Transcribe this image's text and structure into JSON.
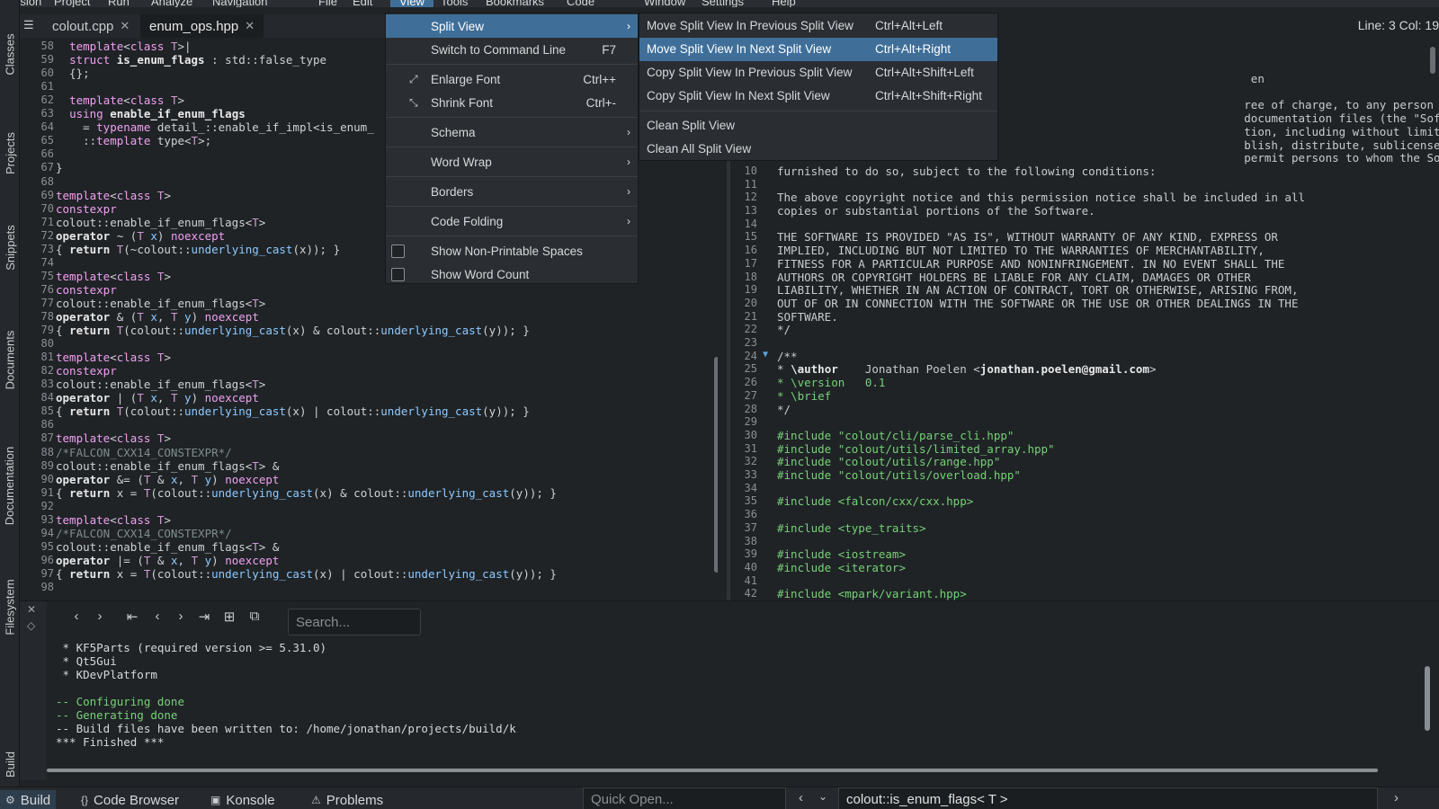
{
  "menubar": {
    "items": [
      "Session",
      "Project",
      "Run",
      "Analyze",
      "Navigation",
      "File",
      "Edit",
      "View",
      "Tools",
      "Bookmarks",
      "Code",
      "Window",
      "Settings",
      "Help"
    ],
    "active": "View"
  },
  "tabs": [
    {
      "label": "colout.cpp"
    },
    {
      "label": "enum_ops.hpp"
    }
  ],
  "tab_close_glyph": "✕",
  "status": {
    "line_col": "Line: 3 Col: 19"
  },
  "left_dock": [
    "Classes",
    "Projects",
    "Snippets",
    "Documents",
    "Documentation",
    "Filesystem",
    "Build"
  ],
  "editor1": {
    "lines": [
      {
        "n": "58",
        "html": "  <span class=\"kw\">template</span>&lt;<span class=\"kw\">class</span> <span class=\"tp\">T</span>&gt;|"
      },
      {
        "n": "59",
        "html": "  <span class=\"kw\">struct</span> <span class=\"bold\">is_enum_flags</span> : std::false_type"
      },
      {
        "n": "60",
        "html": "  {};"
      },
      {
        "n": "61",
        "html": ""
      },
      {
        "n": "62",
        "html": "  <span class=\"kw\">template</span>&lt;<span class=\"kw\">class</span> <span class=\"tp\">T</span>&gt;"
      },
      {
        "n": "63",
        "html": "  <span class=\"kw\">using</span> <span class=\"bold\">enable_if_enum_flags</span>"
      },
      {
        "n": "64",
        "html": "    = <span class=\"kw\">typename</span> detail_::enable_if_impl&lt;is_enum_"
      },
      {
        "n": "65",
        "html": "    ::<span class=\"kw\">template</span> type&lt;<span class=\"tp\">T</span>&gt;;"
      },
      {
        "n": "66",
        "html": ""
      },
      {
        "n": "67",
        "html": "}"
      },
      {
        "n": "68",
        "html": ""
      },
      {
        "n": "69",
        "html": "<span class=\"kw\">template</span>&lt;<span class=\"kw\">class</span> <span class=\"tp\">T</span>&gt;"
      },
      {
        "n": "70",
        "html": "<span class=\"kw\">constexpr</span>"
      },
      {
        "n": "71",
        "html": "colout::enable_if_enum_flags&lt;<span class=\"tp\">T</span>&gt;"
      },
      {
        "n": "72",
        "html": "<span class=\"bold\">operator</span> ~ (<span class=\"tp\">T</span> <span class=\"fn\">x</span>) <span class=\"kw\">noexcept</span>"
      },
      {
        "n": "73",
        "html": "{ <span class=\"bold\">return</span> <span class=\"tp\">T</span>(~colout::<span class=\"fn\">underlying_cast</span>(x)); }"
      },
      {
        "n": "74",
        "html": ""
      },
      {
        "n": "75",
        "html": "<span class=\"kw\">template</span>&lt;<span class=\"kw\">class</span> <span class=\"tp\">T</span>&gt;"
      },
      {
        "n": "76",
        "html": "<span class=\"kw\">constexpr</span>"
      },
      {
        "n": "77",
        "html": "colout::enable_if_enum_flags&lt;<span class=\"tp\">T</span>&gt;"
      },
      {
        "n": "78",
        "html": "<span class=\"bold\">operator</span> &amp; (<span class=\"tp\">T</span> <span class=\"fn\">x</span>, <span class=\"tp\">T</span> <span class=\"fn\">y</span>) <span class=\"kw\">noexcept</span>"
      },
      {
        "n": "79",
        "html": "{ <span class=\"bold\">return</span> <span class=\"tp\">T</span>(colout::<span class=\"fn\">underlying_cast</span>(x) &amp; colout::<span class=\"fn\">underlying_cast</span>(y)); }"
      },
      {
        "n": "80",
        "html": ""
      },
      {
        "n": "81",
        "html": "<span class=\"kw\">template</span>&lt;<span class=\"kw\">class</span> <span class=\"tp\">T</span>&gt;"
      },
      {
        "n": "82",
        "html": "<span class=\"kw\">constexpr</span>"
      },
      {
        "n": "83",
        "html": "colout::enable_if_enum_flags&lt;<span class=\"tp\">T</span>&gt;"
      },
      {
        "n": "84",
        "html": "<span class=\"bold\">operator</span> | (<span class=\"tp\">T</span> <span class=\"fn\">x</span>, <span class=\"tp\">T</span> <span class=\"fn\">y</span>) <span class=\"kw\">noexcept</span>"
      },
      {
        "n": "85",
        "html": "{ <span class=\"bold\">return</span> <span class=\"tp\">T</span>(colout::<span class=\"fn\">underlying_cast</span>(x) | colout::<span class=\"fn\">underlying_cast</span>(y)); }"
      },
      {
        "n": "86",
        "html": ""
      },
      {
        "n": "87",
        "html": "<span class=\"kw\">template</span>&lt;<span class=\"kw\">class</span> <span class=\"tp\">T</span>&gt;"
      },
      {
        "n": "88",
        "html": "<span class=\"cm\">/*FALCON_CXX14_CONSTEXPR*/</span>"
      },
      {
        "n": "89",
        "html": "colout::enable_if_enum_flags&lt;<span class=\"tp\">T</span>&gt; &amp;"
      },
      {
        "n": "90",
        "html": "<span class=\"bold\">operator</span> &amp;= (<span class=\"tp\">T</span> &amp; <span class=\"fn\">x</span>, <span class=\"tp\">T</span> <span class=\"fn\">y</span>) <span class=\"kw\">noexcept</span>"
      },
      {
        "n": "91",
        "html": "{ <span class=\"bold\">return</span> x = <span class=\"tp\">T</span>(colout::<span class=\"fn\">underlying_cast</span>(x) &amp; colout::<span class=\"fn\">underlying_cast</span>(y)); }"
      },
      {
        "n": "92",
        "html": ""
      },
      {
        "n": "93",
        "html": "<span class=\"kw\">template</span>&lt;<span class=\"kw\">class</span> <span class=\"tp\">T</span>&gt;"
      },
      {
        "n": "94",
        "html": "<span class=\"cm\">/*FALCON_CXX14_CONSTEXPR*/</span>"
      },
      {
        "n": "95",
        "html": "colout::enable_if_enum_flags&lt;<span class=\"tp\">T</span>&gt; &amp;"
      },
      {
        "n": "96",
        "html": "<span class=\"bold\">operator</span> |= (<span class=\"tp\">T</span> &amp; <span class=\"fn\">x</span>, <span class=\"tp\">T</span> <span class=\"fn\">y</span>) <span class=\"kw\">noexcept</span>"
      },
      {
        "n": "97",
        "html": "{ <span class=\"bold\">return</span> x = <span class=\"tp\">T</span>(colout::<span class=\"fn\">underlying_cast</span>(x) | colout::<span class=\"fn\">underlying_cast</span>(y)); }"
      },
      {
        "n": "98",
        "html": ""
      }
    ]
  },
  "editor2": {
    "lines": [
      {
        "n": "",
        "html": "                                                                      en"
      },
      {
        "n": "",
        "html": ""
      },
      {
        "n": "",
        "html": "                                                                     ree of charge, to any person obtaining a copy"
      },
      {
        "n": "",
        "html": "                                                                     documentation files (the \"Software\"), to deal"
      },
      {
        "n": "",
        "html": "                                                                     tion, including without limitation the rights"
      },
      {
        "n": "",
        "html": "                                                                     blish, distribute, sublicense, and/or sell"
      },
      {
        "n": "",
        "html": "                                                                     permit persons to whom the Software is"
      },
      {
        "n": "10",
        "html": "furnished to do so, subject to the following conditions:"
      },
      {
        "n": "11",
        "html": ""
      },
      {
        "n": "12",
        "html": "The above copyright notice and this permission notice shall be included in all"
      },
      {
        "n": "13",
        "html": "copies or substantial portions of the Software."
      },
      {
        "n": "14",
        "html": ""
      },
      {
        "n": "15",
        "html": "THE SOFTWARE IS PROVIDED \"AS IS\", WITHOUT WARRANTY OF ANY KIND, EXPRESS OR"
      },
      {
        "n": "16",
        "html": "IMPLIED, INCLUDING BUT NOT LIMITED TO THE WARRANTIES OF MERCHANTABILITY,"
      },
      {
        "n": "17",
        "html": "FITNESS FOR A PARTICULAR PURPOSE AND NONINFRINGEMENT. IN NO EVENT SHALL THE"
      },
      {
        "n": "18",
        "html": "AUTHORS OR COPYRIGHT HOLDERS BE LIABLE FOR ANY CLAIM, DAMAGES OR OTHER"
      },
      {
        "n": "19",
        "html": "LIABILITY, WHETHER IN AN ACTION OF CONTRACT, TORT OR OTHERWISE, ARISING FROM,"
      },
      {
        "n": "20",
        "html": "OUT OF OR IN CONNECTION WITH THE SOFTWARE OR THE USE OR OTHER DEALINGS IN THE"
      },
      {
        "n": "21",
        "html": "SOFTWARE."
      },
      {
        "n": "22",
        "html": "*/"
      },
      {
        "n": "23",
        "html": ""
      },
      {
        "n": "24",
        "html": "/**"
      },
      {
        "n": "25",
        "html": "* <span class=\"bold\">\\author</span>    Jonathan Poelen &lt;<span class=\"bold\">jonathan.poelen@gmail.com</span>&gt;"
      },
      {
        "n": "26",
        "html": "<span class=\"inc\">* \\version   0.1</span>"
      },
      {
        "n": "27",
        "html": "<span class=\"inc\">* \\brief</span>"
      },
      {
        "n": "28",
        "html": "*/"
      },
      {
        "n": "29",
        "html": ""
      },
      {
        "n": "30",
        "html": "<span class=\"inc\">#include \"colout/cli/parse_cli.hpp\"</span>"
      },
      {
        "n": "31",
        "html": "<span class=\"inc\">#include \"colout/utils/limited_array.hpp\"</span>"
      },
      {
        "n": "32",
        "html": "<span class=\"inc\">#include \"colout/utils/range.hpp\"</span>"
      },
      {
        "n": "33",
        "html": "<span class=\"inc\">#include \"colout/utils/overload.hpp\"</span>"
      },
      {
        "n": "34",
        "html": ""
      },
      {
        "n": "35",
        "html": "<span class=\"inc\">#include &lt;falcon/cxx/cxx.hpp&gt;</span>"
      },
      {
        "n": "36",
        "html": ""
      },
      {
        "n": "37",
        "html": "<span class=\"inc\">#include &lt;type_traits&gt;</span>"
      },
      {
        "n": "38",
        "html": ""
      },
      {
        "n": "39",
        "html": "<span class=\"inc\">#include &lt;iostream&gt;</span>"
      },
      {
        "n": "40",
        "html": "<span class=\"inc\">#include &lt;iterator&gt;</span>"
      },
      {
        "n": "41",
        "html": ""
      },
      {
        "n": "42",
        "html": "<span class=\"inc\">#include &lt;mpark/variant.hpp&gt;</span>"
      }
    ]
  },
  "view_menu": {
    "items": [
      {
        "label": "Split View",
        "shortcut": "",
        "submenu": true,
        "highlight": true,
        "icon": "",
        "checkbox": false
      },
      {
        "label": "Switch to Command Line",
        "shortcut": "F7",
        "submenu": false,
        "highlight": false,
        "icon": "",
        "checkbox": false
      },
      {
        "sep": true
      },
      {
        "label": "Enlarge Font",
        "shortcut": "Ctrl++",
        "submenu": false,
        "highlight": false,
        "icon": "enlarge-icon",
        "checkbox": false
      },
      {
        "label": "Shrink Font",
        "shortcut": "Ctrl+-",
        "submenu": false,
        "highlight": false,
        "icon": "shrink-icon",
        "checkbox": false
      },
      {
        "sep": true
      },
      {
        "label": "Schema",
        "shortcut": "",
        "submenu": true,
        "highlight": false,
        "icon": "",
        "checkbox": false
      },
      {
        "sep": true
      },
      {
        "label": "Word Wrap",
        "shortcut": "",
        "submenu": true,
        "highlight": false,
        "icon": "",
        "checkbox": false
      },
      {
        "sep": true
      },
      {
        "label": "Borders",
        "shortcut": "",
        "submenu": true,
        "highlight": false,
        "icon": "",
        "checkbox": false
      },
      {
        "sep": true
      },
      {
        "label": "Code Folding",
        "shortcut": "",
        "submenu": true,
        "highlight": false,
        "icon": "",
        "checkbox": false
      },
      {
        "sep": true
      },
      {
        "label": "Show Non-Printable Spaces",
        "shortcut": "",
        "submenu": false,
        "highlight": false,
        "icon": "",
        "checkbox": true
      },
      {
        "label": "Show Word Count",
        "shortcut": "",
        "submenu": false,
        "highlight": false,
        "icon": "",
        "checkbox": true
      }
    ]
  },
  "split_submenu": {
    "items": [
      {
        "label": "Move Split View In Previous Split View",
        "shortcut": "Ctrl+Alt+Left",
        "highlight": false
      },
      {
        "label": "Move Split View In Next Split View",
        "shortcut": "Ctrl+Alt+Right",
        "highlight": true
      },
      {
        "label": "Copy Split View In Previous Split View",
        "shortcut": "Ctrl+Alt+Shift+Left",
        "highlight": false
      },
      {
        "label": "Copy Split View In Next Split View",
        "shortcut": "Ctrl+Alt+Shift+Right",
        "highlight": false
      },
      {
        "sep": true
      },
      {
        "label": "Clean Split View",
        "shortcut": "",
        "highlight": false
      },
      {
        "label": "Clean All Split View",
        "shortcut": "",
        "highlight": false
      }
    ]
  },
  "build": {
    "search_placeholder": "Search...",
    "output": [
      {
        "text": " * KF5Parts (required version >= 5.31.0)",
        "green": false
      },
      {
        "text": " * Qt5Gui",
        "green": false
      },
      {
        "text": " * KDevPlatform",
        "green": false
      },
      {
        "text": "",
        "green": false
      },
      {
        "text": "-- Configuring done",
        "green": true
      },
      {
        "text": "-- Generating done",
        "green": true
      },
      {
        "text": "-- Build files have been written to: /home/jonathan/projects/build/k",
        "green": false
      },
      {
        "text": "*** Finished ***",
        "green": false
      }
    ]
  },
  "statusbar": {
    "tabs": [
      {
        "label": "Build",
        "icon": "gear-icon",
        "glyph": "⚙"
      },
      {
        "label": "Code Browser",
        "icon": "braces-icon",
        "glyph": "{}"
      },
      {
        "label": "Konsole",
        "icon": "terminal-icon",
        "glyph": "▣"
      },
      {
        "label": "Problems",
        "icon": "problems-icon",
        "glyph": "⚠"
      }
    ],
    "quick_open_placeholder": "Quick Open...",
    "context": "colout::is_enum_flags< T >"
  }
}
